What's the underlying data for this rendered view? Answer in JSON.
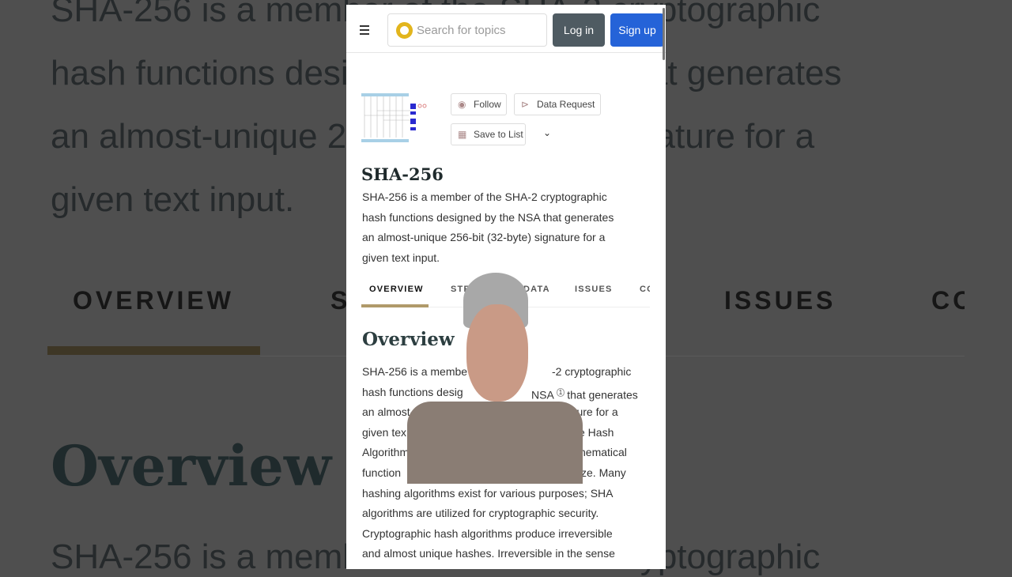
{
  "header": {
    "search_placeholder": "Search for topics",
    "login": "Log in",
    "signup": "Sign up"
  },
  "actions": {
    "follow": "Follow",
    "data_request": "Data Request",
    "save_to_list": "Save to List"
  },
  "title": "SHA-256",
  "description_lines": [
    "SHA-256 is a member of the SHA-2 cryptographic",
    "hash functions designed by the NSA that generates",
    "an almost-unique 256-bit (32-byte) signature for a",
    "given text input."
  ],
  "tabs": [
    "OVERVIEW",
    "STRUCTURED DATA",
    "ISSUES",
    "CO"
  ],
  "overview": {
    "heading": "Overview",
    "lines": [
      [
        "SHA-256 is a membe",
        "-2 cryptographic"
      ],
      [
        "hash functions desig",
        "NSA",
        "that generates"
      ],
      [
        "an almost-uni",
        "nature for a"
      ],
      [
        "given tex",
        "e Hash"
      ],
      [
        "Algorithm",
        "hematical"
      ],
      [
        "function",
        "ze. Many"
      ],
      [
        "hashing algorithms exist for various purposes; SHA"
      ],
      [
        "algorithms are utilized for cryptographic security."
      ],
      [
        "Cryptographic hash algorithms produce irreversible"
      ],
      [
        "and almost unique hashes. Irreversible in the sense"
      ]
    ],
    "footnote": "1"
  },
  "colors": {
    "accent": "#b09a6a",
    "signup": "#2563d8",
    "login": "#4f5b62",
    "logo": "#e2b51d"
  }
}
